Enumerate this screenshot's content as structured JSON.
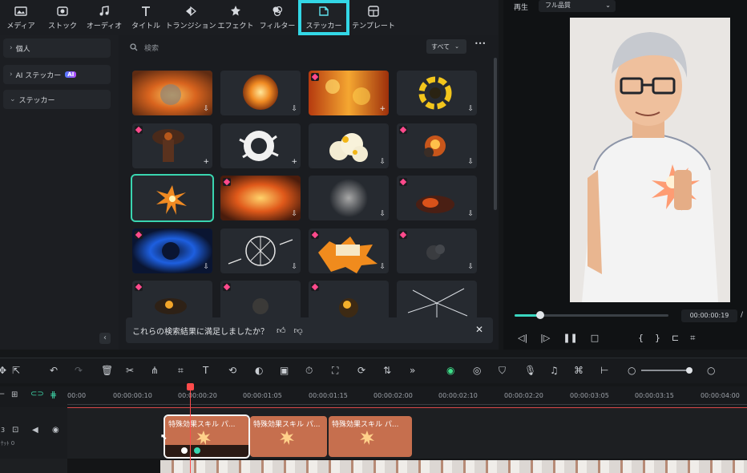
{
  "top_tabs": [
    {
      "label": "メディア",
      "icon": "media-icon"
    },
    {
      "label": "ストック",
      "icon": "stock-icon"
    },
    {
      "label": "オーディオ",
      "icon": "music-icon"
    },
    {
      "label": "タイトル",
      "icon": "title-icon"
    },
    {
      "label": "トランジション",
      "icon": "transition-icon"
    },
    {
      "label": "エフェクト",
      "icon": "effect-icon"
    },
    {
      "label": "フィルター",
      "icon": "filter-icon"
    },
    {
      "label": "ステッカー",
      "icon": "sticker-icon",
      "active": true
    },
    {
      "label": "テンプレート",
      "icon": "template-icon"
    }
  ],
  "sidebar": {
    "items": [
      {
        "prefix": "›",
        "label": "個人"
      },
      {
        "prefix": "›",
        "label": "AI ステッカー",
        "badge": "AI"
      },
      {
        "prefix": "⌄",
        "label": "ステッカー"
      }
    ],
    "collapse": "‹"
  },
  "search": {
    "placeholder": "検索",
    "filter": "すべて",
    "more": "•••"
  },
  "feedback": {
    "text": "これらの検索結果に満足しましたか？"
  },
  "player": {
    "label": "再生",
    "quality": "フル品質",
    "time": "00:00:00:19",
    "slash": "/"
  },
  "ruler": {
    "ticks": [
      "00:00",
      "00:00:00:10",
      "00:00:00:20",
      "00:00:01:05",
      "00:00:01:15",
      "00:00:02:00",
      "00:00:02:10",
      "00:00:02:20",
      "00:00:03:05",
      "00:00:03:15",
      "00:00:04:00"
    ]
  },
  "clips": [
    {
      "label": "特殊効果スキル パ..."
    },
    {
      "label": "特殊効果スキル パ..."
    },
    {
      "label": "特殊効果スキル パ..."
    }
  ],
  "track": {
    "number": "3",
    "sub": "ｹｯﾄ 0"
  },
  "colors": {
    "accent": "#33d7e6",
    "clip": "#c66f4e",
    "playhead": "#ff4b4b",
    "selected": "#39d5b0",
    "premium": "#ff4a8c"
  }
}
